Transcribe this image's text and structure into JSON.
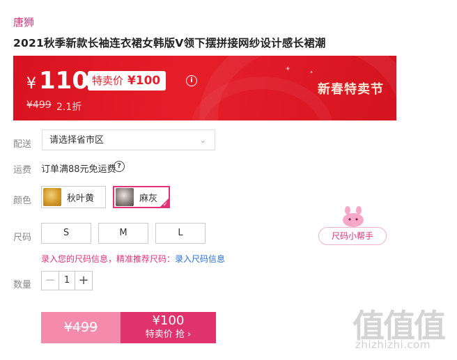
{
  "store": {
    "name": "唐狮"
  },
  "product": {
    "title": "2021秋季新款长袖连衣裙女韩版V领下摆拼接网纱设计感长裙潮"
  },
  "price_banner": {
    "currency": "¥",
    "current_price": "110",
    "special_label": "特卖价",
    "special_price": "¥100",
    "original_price": "¥499",
    "discount": "2.1折",
    "festival": "新春特卖节",
    "info_icon": "i"
  },
  "delivery": {
    "label": "配送",
    "placeholder": "请选择省市区"
  },
  "shipping": {
    "label": "运费",
    "text": "订单满88元免运费"
  },
  "color": {
    "label": "颜色",
    "options": [
      {
        "name": "秋叶黄",
        "selected": false
      },
      {
        "name": "麻灰",
        "selected": true
      }
    ]
  },
  "size": {
    "label": "尺码",
    "options": [
      "S",
      "M",
      "L"
    ],
    "hint_prefix": "录入您的尺码信息，精准推荐尺码：",
    "hint_link": "录入尺码信息",
    "helper_label": "尺码小帮手"
  },
  "quantity": {
    "label": "数量",
    "value": "1",
    "minus": "−",
    "plus": "+"
  },
  "buy": {
    "original_price": "¥499",
    "special_price": "¥100",
    "action_label": "特卖价 抢 ›"
  },
  "watermark": {
    "logo": "值值值",
    "url": "zhizhizhi.com"
  },
  "colors": {
    "accent": "#e0317a",
    "banner_red": "#e61e2a",
    "buy_pink": "#f48bad",
    "buy_deep": "#e0336e"
  }
}
